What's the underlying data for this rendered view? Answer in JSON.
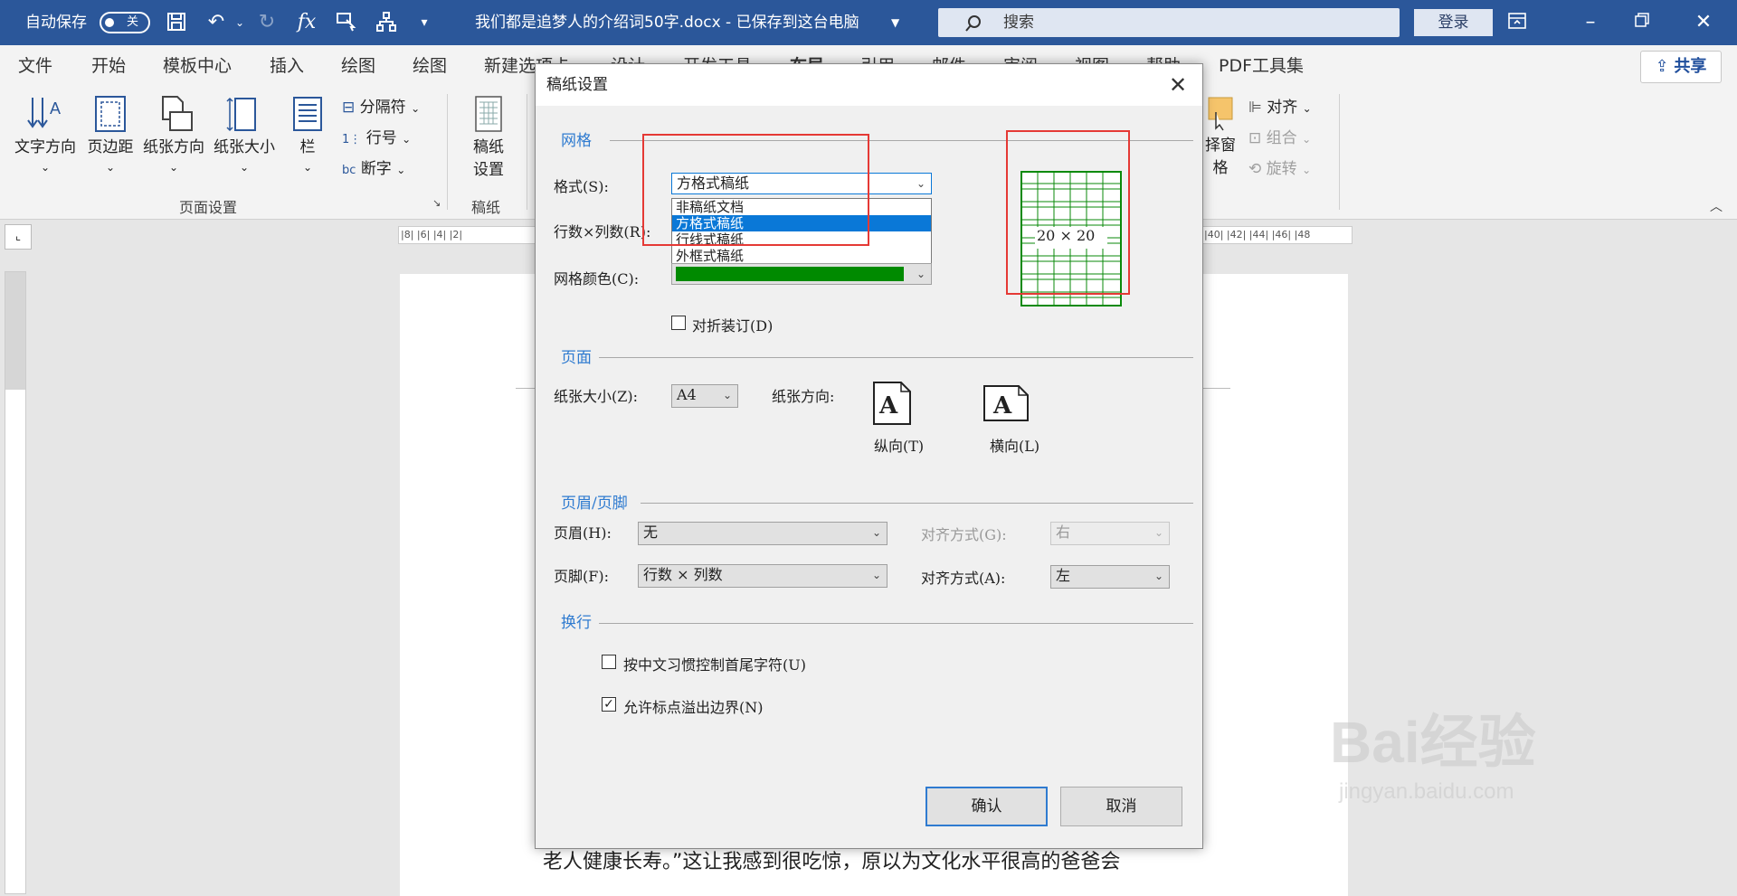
{
  "titlebar": {
    "autosave_label": "自动保存",
    "autosave_state": "关",
    "doc_title": "我们都是追梦人的介绍词50字.docx  -  已保存到这台电脑",
    "search_placeholder": "搜索",
    "login": "登录",
    "icons": [
      "save-icon",
      "undo-icon",
      "redo-icon",
      "fx-icon",
      "touch-mode-icon",
      "hierarchy-icon",
      "customize-icon",
      "ribbon-display-icon",
      "minimize-icon",
      "restore-icon",
      "close-icon"
    ]
  },
  "tabs": [
    "文件",
    "开始",
    "模板中心",
    "插入",
    "绘图",
    "绘图",
    "新建选项卡",
    "设计",
    "开发工具",
    "布局",
    "引用",
    "邮件",
    "审阅",
    "视图",
    "帮助",
    "PDF工具集"
  ],
  "share": "共享",
  "ribbon": {
    "page_setup": {
      "text_direction": "文字方向",
      "margins": "页边距",
      "orientation": "纸张方向",
      "size": "纸张大小",
      "columns": "栏",
      "breaks": "分隔符",
      "line_numbers": "行号",
      "hyphenation": "断字",
      "group_label": "页面设置"
    },
    "manuscript": {
      "btn_line1": "稿纸",
      "btn_line2": "设置",
      "group_label": "稿纸"
    },
    "arrange": {
      "selection_pane": "择窗格",
      "align": "对齐",
      "group": "组合",
      "rotate": "旋转"
    }
  },
  "document": {
    "ruler_top": "|8|  |6|  |4|  |2|",
    "ruler_top_right": "|40|  |42|  |44|  |46|  |48",
    "body_text": "老人健康长寿。”这让我感到很吃惊，原以为文化水平很高的爸爸会",
    "watermark": "Bai经验",
    "watermark_sub": "jingyan.baidu.com"
  },
  "dialog": {
    "title": "稿纸设置",
    "grid_section": "网格",
    "format_label": "格式(S):",
    "format_value": "方格式稿纸",
    "format_options": [
      "非稿纸文档",
      "方格式稿纸",
      "行线式稿纸",
      "外框式稿纸"
    ],
    "format_selected_index": 1,
    "rowcol_label": "行数×列数(R):",
    "grid_color_label": "网格颜色(C):",
    "grid_color": "#008a00",
    "fold_label": "对折装订(D)",
    "fold_checked": false,
    "preview_text": "20 × 20",
    "page_section": "页面",
    "paper_size_label": "纸张大小(Z):",
    "paper_size_value": "A4",
    "orientation_label": "纸张方向:",
    "portrait_label": "纵向(T)",
    "landscape_label": "横向(L)",
    "hf_section": "页眉/页脚",
    "header_label": "页眉(H):",
    "header_value": "无",
    "header_align_label": "对齐方式(G):",
    "header_align_value": "右",
    "footer_label": "页脚(F):",
    "footer_value": "行数 × 列数",
    "footer_align_label": "对齐方式(A):",
    "footer_align_value": "左",
    "wrap_section": "换行",
    "cjk_label": "按中文习惯控制首尾字符(U)",
    "cjk_checked": false,
    "punct_label": "允许标点溢出边界(N)",
    "punct_checked": true,
    "ok": "确认",
    "cancel": "取消"
  }
}
